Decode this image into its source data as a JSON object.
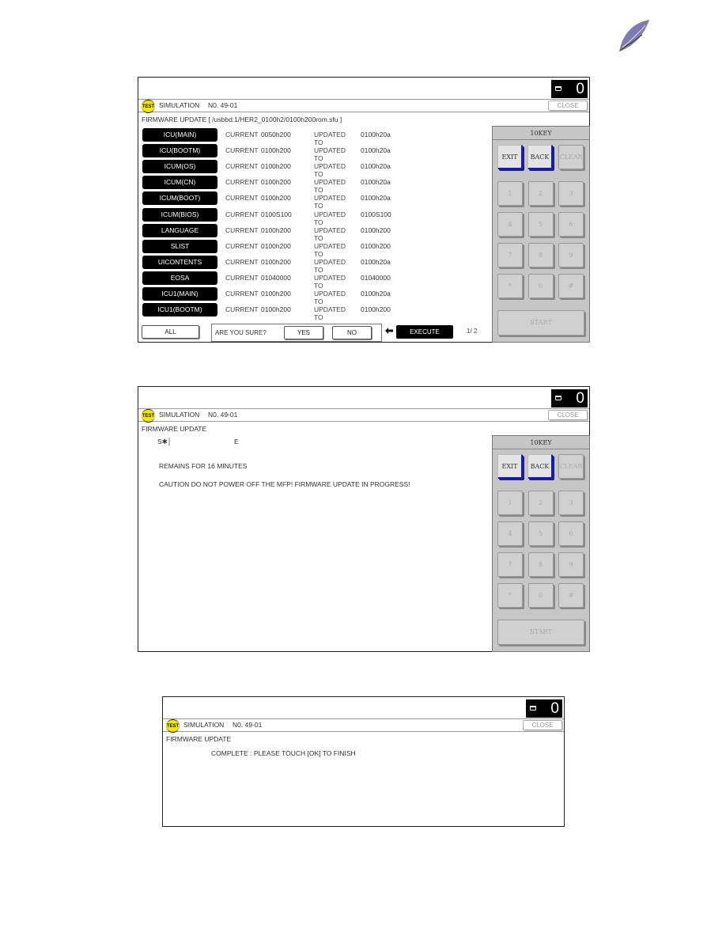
{
  "common": {
    "counter_value": "0",
    "test_badge": "TEST",
    "simulation_label": "SIMULATION",
    "simulation_no": "N0. 49-01",
    "close_label": "CLOSE",
    "firmware_update_label": "FIRMWARE UPDATE"
  },
  "screen1": {
    "file_path": "[  /usbbd:1/HER2_0100h2/0100h200rom.sfu  ]",
    "current_label": "CURRENT",
    "updated_label": "UPDATED TO",
    "rows": [
      {
        "unit": "ICU(MAIN)",
        "current": "0050h200",
        "updated": "0100h20a"
      },
      {
        "unit": "ICU(BOOTM)",
        "current": "0100h200",
        "updated": "0100h20a"
      },
      {
        "unit": "ICUM(OS)",
        "current": "0100h200",
        "updated": "0100h20a"
      },
      {
        "unit": "ICUM(CN)",
        "current": "0100h200",
        "updated": "0100h20a"
      },
      {
        "unit": "ICUM(BOOT)",
        "current": "0100h200",
        "updated": "0100h20a"
      },
      {
        "unit": "ICUM(BIOS)",
        "current": "0100S100",
        "updated": "0100S100"
      },
      {
        "unit": "LANGUAGE",
        "current": "0100h200",
        "updated": "0100h200"
      },
      {
        "unit": "SLIST",
        "current": "0100h200",
        "updated": "0100h200"
      },
      {
        "unit": "UICONTENTS",
        "current": "0100h200",
        "updated": "0100h20a"
      },
      {
        "unit": "EOSA",
        "current": "01040000",
        "updated": "01040000"
      },
      {
        "unit": "ICU1(MAIN)",
        "current": "0100h200",
        "updated": "0100h20a"
      },
      {
        "unit": "ICU1(BOOTM)",
        "current": "0100h200",
        "updated": "0100h200"
      }
    ],
    "all_label": "ALL",
    "confirm_label": "ARE YOU SURE?",
    "yes_label": "YES",
    "no_label": "NO",
    "execute_label": "EXECUTE",
    "page_indicator": "1/ 2"
  },
  "screen2": {
    "progress_text": "S✱│",
    "progress_end": "E",
    "remains_text": "REMAINS FOR 16 MINUTES",
    "caution_text": "CAUTION DO NOT POWER OFF THE MFP!  FIRMWARE UPDATE IN PROGRESS!"
  },
  "screen3": {
    "complete_text": "COMPLETE  :  PLEASE TOUCH [OK] TO FINISH"
  },
  "tenkey": {
    "title": "10KEY",
    "exit": "EXIT",
    "back": "BACK",
    "clear": "CLEAR",
    "digits": [
      "1",
      "2",
      "3",
      "4",
      "5",
      "6",
      "7",
      "8",
      "9",
      "*",
      "0",
      "#"
    ],
    "start": "START"
  },
  "colors": {
    "key_accent": "#1a1aa8",
    "test_badge": "#f2e600",
    "tenkey_bg": "#c6c6c6"
  }
}
